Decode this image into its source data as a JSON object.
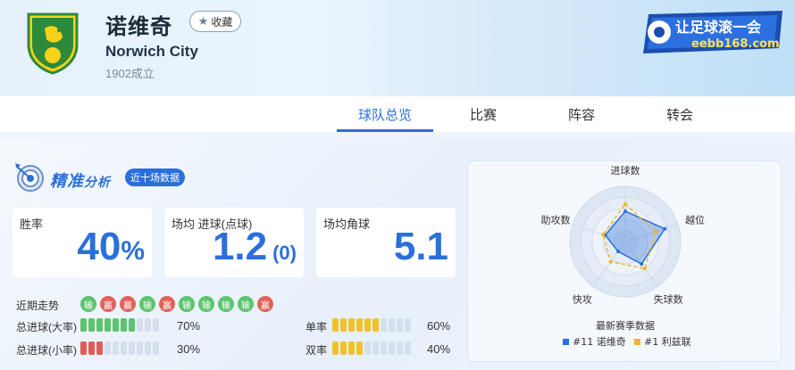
{
  "team": {
    "name_cn": "诺维奇",
    "name_en": "Norwich City",
    "founded": "1902成立",
    "favorite_label": "收藏"
  },
  "brand": {
    "text": "让足球滚一会",
    "url": "eebb168.com"
  },
  "tabs": [
    {
      "label": "球队总览",
      "active": true
    },
    {
      "label": "比赛",
      "active": false
    },
    {
      "label": "阵容",
      "active": false
    },
    {
      "label": "转会",
      "active": false
    }
  ],
  "analysis": {
    "title": "精准",
    "title_sub": "分析",
    "badge": "近十场数据",
    "cards": [
      {
        "label": "胜率",
        "value": "40",
        "unit": "%"
      },
      {
        "label": "场均 进球(点球)",
        "value": "1.2",
        "extra": "(0)"
      },
      {
        "label": "场均角球",
        "value": "5.1"
      }
    ],
    "trend_label": "近期走势",
    "trend": [
      "输",
      "赢",
      "赢",
      "输",
      "赢",
      "输",
      "输",
      "输",
      "输",
      "赢"
    ],
    "bars": [
      {
        "label": "总进球(大率)",
        "filled": 7,
        "total": 10,
        "color": "#5dc46e",
        "pct": "70%"
      },
      {
        "label": "总进球(小率)",
        "filled": 3,
        "total": 10,
        "color": "#e05a5a",
        "pct": "30%"
      },
      {
        "label": "单率",
        "filled": 6,
        "total": 10,
        "color": "#f2c12e",
        "pct": "60%"
      },
      {
        "label": "双率",
        "filled": 4,
        "total": 10,
        "color": "#f2c12e",
        "pct": "40%"
      }
    ],
    "colors": {
      "win": "#e0635a",
      "lose": "#5dc46e",
      "accent": "#2a6fdb"
    }
  },
  "radar": {
    "axes": [
      "进球数",
      "越位",
      "失球数",
      "快攻",
      "助攻数"
    ],
    "series": [
      {
        "name": "#11 诺维奇",
        "color": "#2a6fdb",
        "values": [
          0.55,
          0.75,
          0.5,
          0.22,
          0.38
        ]
      },
      {
        "name": "#1 利兹联",
        "color": "#f0b429",
        "values": [
          0.68,
          0.58,
          0.6,
          0.45,
          0.42
        ]
      }
    ],
    "caption": "最新赛季数据"
  }
}
